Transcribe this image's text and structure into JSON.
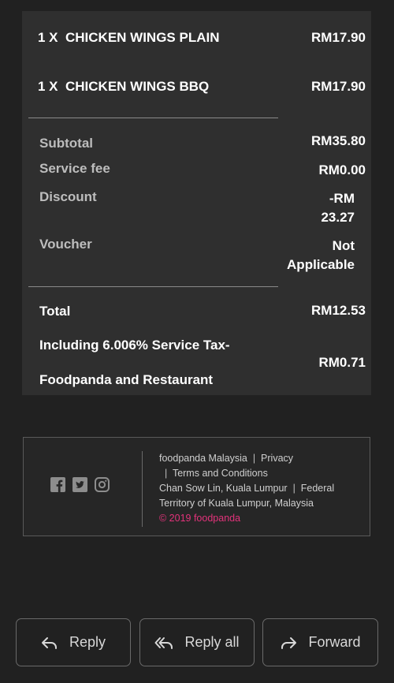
{
  "items": [
    {
      "qty": "1 X",
      "name": "CHICKEN WINGS PLAIN",
      "price": "RM17.90"
    },
    {
      "qty": "1 X",
      "name": "CHICKEN WINGS BBQ",
      "price": "RM17.90"
    }
  ],
  "summary": {
    "subtotal_label": "Subtotal",
    "subtotal_value": "RM35.80",
    "service_fee_label": "Service fee",
    "service_fee_value": "RM0.00",
    "discount_label": "Discount",
    "discount_value_line1": "-RM",
    "discount_value_line2": "23.27",
    "voucher_label": "Voucher",
    "voucher_value_line1": "Not",
    "voucher_value_line2": "Applicable"
  },
  "total": {
    "label": "Total",
    "value": "RM12.53",
    "tax_label_line1": "Including 6.006% Service Tax-",
    "tax_label_line2": "Foodpanda and Restaurant",
    "tax_value": "RM0.71"
  },
  "footer": {
    "company": "foodpanda Malaysia",
    "privacy": "Privacy",
    "terms": "Terms and Conditions",
    "address_line1": "Chan Sow Lin, Kuala Lumpur",
    "address_line1b": "Federal",
    "address_line2": "Territory of Kuala Lumpur, Malaysia",
    "copyright": "© 2019 foodpanda",
    "pipe": "|"
  },
  "actions": {
    "reply": "Reply",
    "reply_all": "Reply all",
    "forward": "Forward"
  },
  "colors": {
    "background": "#212121",
    "card": "#2f2f2f",
    "brand_pink": "#e3337b"
  },
  "icons": [
    "facebook-icon",
    "twitter-icon",
    "instagram-icon",
    "reply-icon",
    "reply-all-icon",
    "forward-icon"
  ]
}
